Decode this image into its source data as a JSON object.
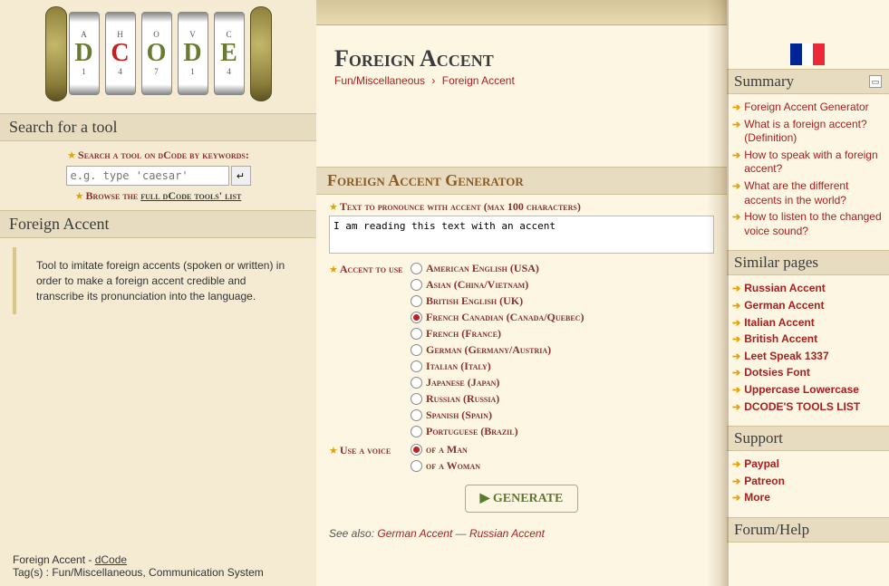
{
  "logo_letters": [
    "D",
    "C",
    "O",
    "D",
    "E"
  ],
  "left": {
    "search_head": "Search for a tool",
    "search_label": "Search a tool on dCode by keywords:",
    "search_placeholder": "e.g. type 'caesar'",
    "search_btn": "↵",
    "browse_prefix": "Browse the ",
    "browse_link": "full dCode tools' list",
    "accent_head": "Foreign Accent",
    "description": "Tool to imitate foreign accents (spoken or written) in order to make a foreign accent credible and transcribe its pronunciation into the language.",
    "footer_line1_a": "Foreign Accent - ",
    "footer_line1_b": "dCode",
    "footer_line2": "Tag(s) : Fun/Miscellaneous, Communication System"
  },
  "mid": {
    "title": "Foreign Accent",
    "crumb_a": "Fun/Miscellaneous",
    "crumb_sep": "›",
    "crumb_b": "Foreign Accent",
    "gen_title": "Foreign Accent Generator",
    "text_label": "Text to pronounce with accent (max 100 characters)",
    "text_value": "I am reading this text with an accent",
    "accent_label": "Accent to use",
    "accents": [
      "American English (USA)",
      "Asian (China/Vietnam)",
      "British English (UK)",
      "French Canadian (Canada/Quebec)",
      "French (France)",
      "German (Germany/Austria)",
      "Italian (Italy)",
      "Japanese (Japan)",
      "Russian (Russia)",
      "Spanish (Spain)",
      "Portuguese (Brazil)"
    ],
    "accent_selected": 3,
    "voice_label": "Use a voice",
    "voices": [
      "of a Man",
      "of a Woman"
    ],
    "voice_selected": 0,
    "generate": "GENERATE",
    "see_also_prefix": "See also: ",
    "see_also_a": "German Accent",
    "see_also_sep": " — ",
    "see_also_b": "Russian Accent"
  },
  "right": {
    "summary_head": "Summary",
    "summary": [
      "Foreign Accent Generator",
      "What is a foreign accent? (Definition)",
      "How to speak with a foreign accent?",
      "What are the different accents in the world?",
      "How to listen to the changed voice sound?"
    ],
    "similar_head": "Similar pages",
    "similar": [
      "Russian Accent",
      "German Accent",
      "Italian Accent",
      "British Accent",
      "Leet Speak 1337",
      "Dotsies Font",
      "Uppercase Lowercase",
      "DCODE'S TOOLS LIST"
    ],
    "support_head": "Support",
    "support": [
      "Paypal",
      "Patreon",
      "More"
    ],
    "forum_head": "Forum/Help"
  }
}
